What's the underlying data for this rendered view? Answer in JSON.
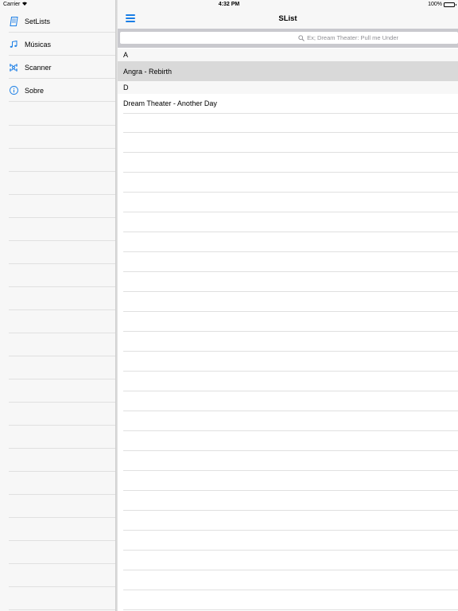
{
  "status_bar": {
    "carrier": "Carrier",
    "time": "4:32 PM",
    "battery": "100%",
    "battery_level": 1.0
  },
  "sidebar": {
    "items": [
      {
        "label": "SetLists",
        "icon": "book-icon"
      },
      {
        "label": "Músicas",
        "icon": "music-note-icon"
      },
      {
        "label": "Scanner",
        "icon": "scanner-icon"
      },
      {
        "label": "Sobre",
        "icon": "info-icon"
      }
    ]
  },
  "nav": {
    "title": "SList",
    "menu_icon": "hamburger-menu-icon"
  },
  "search": {
    "placeholder": "Ex; Dream Theater: Pull me Under"
  },
  "sections": [
    {
      "header": "A",
      "rows": [
        {
          "label": "Angra - Rebirth",
          "selected": true
        }
      ]
    },
    {
      "header": "D",
      "rows": [
        {
          "label": "Dream Theater - Another Day",
          "selected": false
        }
      ]
    }
  ],
  "colors": {
    "accent": "#1a7ee6",
    "selected_row": "#d9d9d9",
    "search_bar_bg": "#c9c9ce"
  }
}
